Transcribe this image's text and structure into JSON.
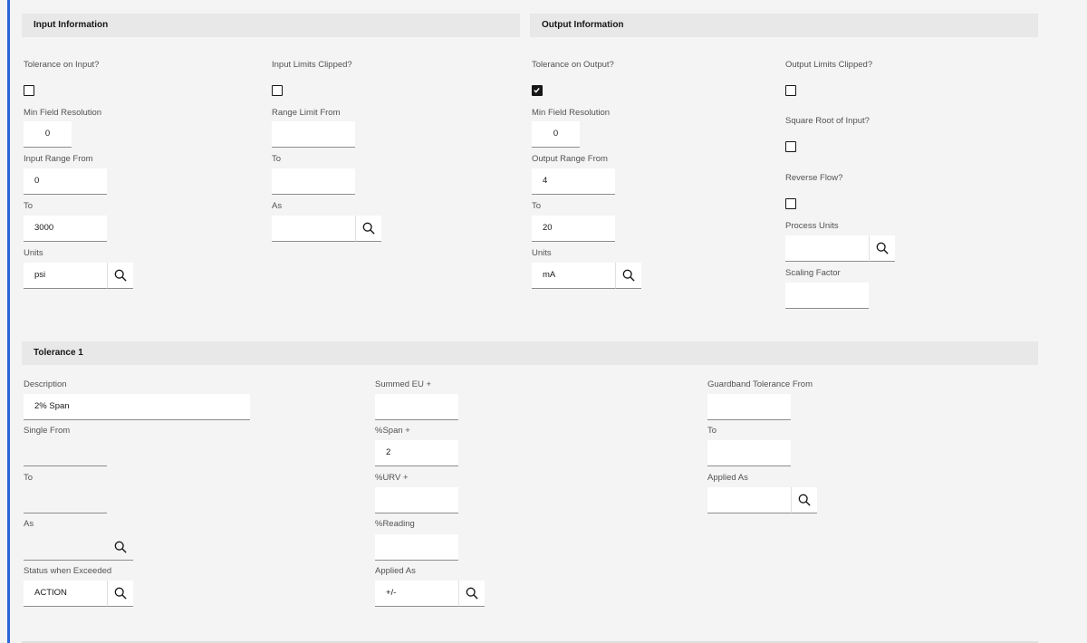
{
  "input_info": {
    "title": "Input Information",
    "tolerance_on_input": {
      "label": "Tolerance on Input?",
      "checked": false
    },
    "input_limits_clipped": {
      "label": "Input Limits Clipped?",
      "checked": false
    },
    "min_field_resolution": {
      "label": "Min Field Resolution",
      "value": "0"
    },
    "range_limit_from": {
      "label": "Range Limit From",
      "value": ""
    },
    "input_range_from": {
      "label": "Input Range From",
      "value": "0"
    },
    "range_limit_to": {
      "label": "To",
      "value": ""
    },
    "input_range_to": {
      "label": "To",
      "value": "3000"
    },
    "range_limit_as": {
      "label": "As",
      "value": ""
    },
    "units": {
      "label": "Units",
      "value": "psi"
    }
  },
  "output_info": {
    "title": "Output Information",
    "tolerance_on_output": {
      "label": "Tolerance on Output?",
      "checked": true
    },
    "output_limits_clipped": {
      "label": "Output Limits Clipped?",
      "checked": false
    },
    "min_field_resolution": {
      "label": "Min Field Resolution",
      "value": "0"
    },
    "square_root_of_input": {
      "label": "Square Root of Input?",
      "checked": false
    },
    "output_range_from": {
      "label": "Output Range From",
      "value": "4"
    },
    "reverse_flow": {
      "label": "Reverse Flow?",
      "checked": false
    },
    "output_range_to": {
      "label": "To",
      "value": "20"
    },
    "process_units": {
      "label": "Process Units",
      "value": ""
    },
    "units": {
      "label": "Units",
      "value": "mA"
    },
    "scaling_factor": {
      "label": "Scaling Factor",
      "value": ""
    }
  },
  "tolerance1": {
    "title": "Tolerance 1",
    "description": {
      "label": "Description",
      "value": "2% Span"
    },
    "single_from": {
      "label": "Single From",
      "value": ""
    },
    "single_to": {
      "label": "To",
      "value": ""
    },
    "single_as": {
      "label": "As",
      "value": ""
    },
    "status_when_exceeded": {
      "label": "Status when Exceeded",
      "value": "ACTION"
    },
    "summed_eu": {
      "label": "Summed EU +",
      "value": ""
    },
    "span_pct": {
      "label": "%Span +",
      "value": "2"
    },
    "urv_pct": {
      "label": "%URV +",
      "value": ""
    },
    "reading_pct": {
      "label": "%Reading",
      "value": ""
    },
    "applied_as_mid": {
      "label": "Applied As",
      "value": "+/-"
    },
    "guardband_from": {
      "label": "Guardband Tolerance From",
      "value": ""
    },
    "guardband_to": {
      "label": "To",
      "value": ""
    },
    "applied_as_right": {
      "label": "Applied As",
      "value": ""
    }
  },
  "icons": {
    "search": "search-icon",
    "checkmark": "checkmark-icon"
  },
  "colors": {
    "accent": "#2a65d9",
    "background": "#f4f4f4",
    "header_background": "#e8e8e8"
  }
}
